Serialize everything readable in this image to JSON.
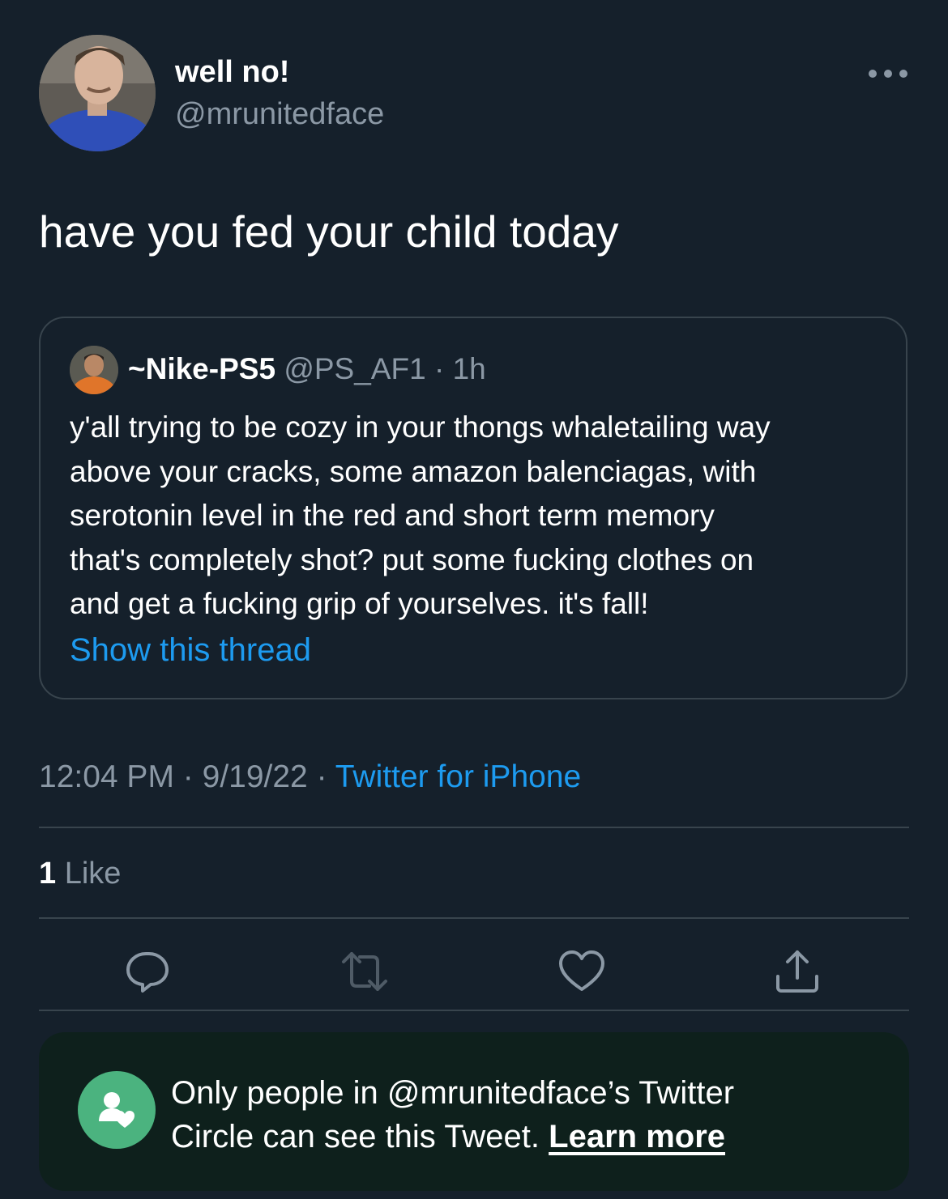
{
  "author": {
    "display_name": "well no!",
    "handle": "@mrunitedface"
  },
  "tweet": {
    "text": "have you fed your child today"
  },
  "quoted_tweet": {
    "display_name": "~Nike-PS5",
    "handle": "@PS_AF1",
    "separator": "·",
    "time": "1h",
    "lines": [
      "y'all trying to be cozy in your thongs whaletailing way",
      "above your cracks, some amazon balenciagas, with",
      "serotonin level in the red and short term memory",
      "that's completely shot? put some fucking clothes on",
      "and get a fucking grip of yourselves. it's fall!"
    ],
    "show_thread_label": "Show this thread"
  },
  "meta": {
    "time": "12:04 PM",
    "separator": "·",
    "date": "9/19/22",
    "source": "Twitter for iPhone"
  },
  "stats": {
    "like_count": "1",
    "like_label": "Like"
  },
  "actions": {
    "icons": [
      "reply-icon",
      "retweet-icon",
      "like-icon",
      "share-icon"
    ]
  },
  "circle_notice": {
    "line1": "Only people in @mrunitedface’s Twitter",
    "line2_prefix": "Circle can see this Tweet.",
    "learn_more": "Learn more",
    "icon": "twitter-circle-icon"
  },
  "colors": {
    "background": "#15202b",
    "accent": "#1d9bf0",
    "muted_text": "#8b98a5",
    "border": "#38444d",
    "notice_background": "#0e201c",
    "notice_icon": "#4bb37f"
  }
}
